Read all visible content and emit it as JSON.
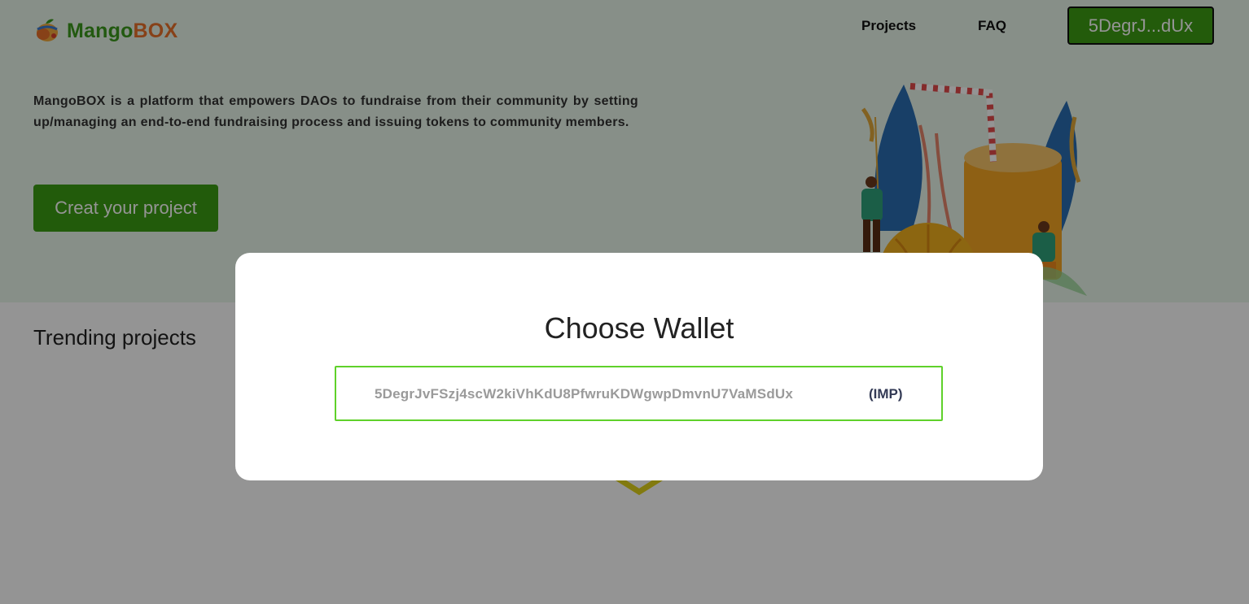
{
  "header": {
    "logo_text_part1": "Mango",
    "logo_text_part2": "BOX",
    "nav": {
      "projects": "Projects",
      "faq": "FAQ"
    },
    "wallet_button": "5DegrJ...dUx"
  },
  "hero": {
    "description": "MangoBOX is a platform that empowers DAOs to fundraise from their community by setting up/managing an end-to-end fundraising process and issuing tokens to community members.",
    "create_button": "Creat your project"
  },
  "main": {
    "trending_title": "Trending projects"
  },
  "modal": {
    "title": "Choose Wallet",
    "wallets": [
      {
        "address": "5DegrJvFSzj4scW2kiVhKdU8PfwruKDWgwpDmvnU7VaMSdUx",
        "name": "(IMP)"
      }
    ]
  },
  "colors": {
    "brand_green": "#3c9d14",
    "brand_orange": "#e8702a",
    "hero_bg": "#e9f6ea",
    "modal_border": "#5fd12a"
  },
  "icons": {
    "logo": "mango-logo-icon",
    "illustration": "hero-illustration"
  }
}
